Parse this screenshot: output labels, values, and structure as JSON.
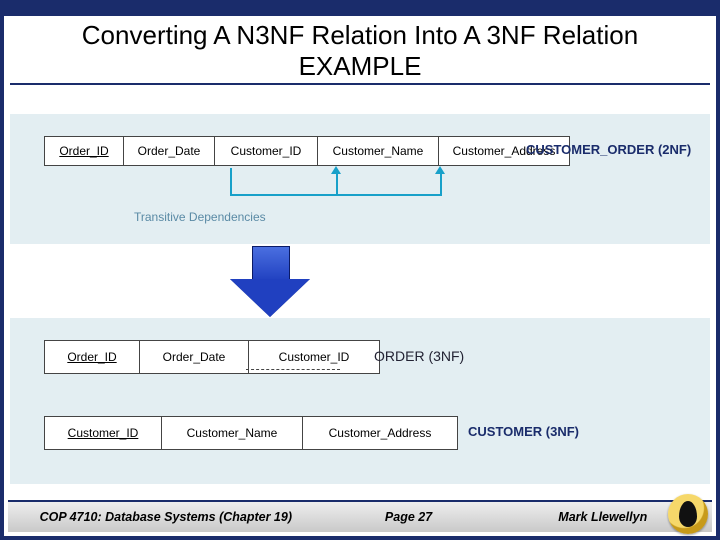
{
  "title_line1": "Converting A N3NF Relation Into A 3NF Relation",
  "title_line2": "EXAMPLE",
  "top": {
    "relation": [
      "Order_ID",
      "Order_Date",
      "Customer_ID",
      "Customer_Name",
      "Customer_Address"
    ],
    "relation_label": "CUSTOMER_ORDER (2NF)",
    "dep_label": "Transitive Dependencies"
  },
  "bottom": {
    "order": [
      "Order_ID",
      "Order_Date",
      "Customer_ID"
    ],
    "order_label": "ORDER (3NF)",
    "customer": [
      "Customer_ID",
      "Customer_Name",
      "Customer_Address"
    ],
    "customer_label": "CUSTOMER (3NF)"
  },
  "footer": {
    "course": "COP 4710: Database Systems  (Chapter 19)",
    "page": "Page 27",
    "author": "Mark Llewellyn"
  }
}
